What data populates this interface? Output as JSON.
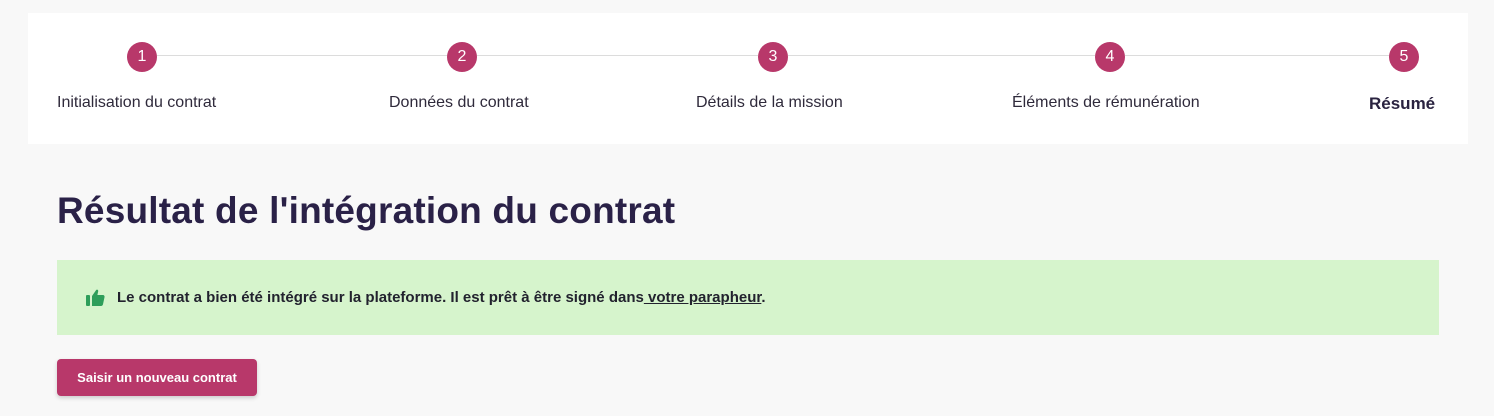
{
  "stepper": {
    "steps": [
      {
        "number": "1",
        "label": "Initialisation du contrat"
      },
      {
        "number": "2",
        "label": "Données du contrat"
      },
      {
        "number": "3",
        "label": "Détails de la mission"
      },
      {
        "number": "4",
        "label": "Éléments de rémunération"
      },
      {
        "number": "5",
        "label": "Résumé"
      }
    ],
    "active_step": "5"
  },
  "main": {
    "title": "Résultat de l'intégration du contrat",
    "alert": {
      "icon": "thumbs-up-icon",
      "text": "Le contrat a bien été intégré sur la plateforme. Il est prêt à être signé dans",
      "link_text": " votre parapheur",
      "suffix": "."
    },
    "new_contract_button": "Saisir un nouveau contrat"
  },
  "colors": {
    "accent": "#b8386a",
    "success_bg": "#d6f4cc",
    "success_icon": "#2e9e5a",
    "title": "#2a2147"
  }
}
